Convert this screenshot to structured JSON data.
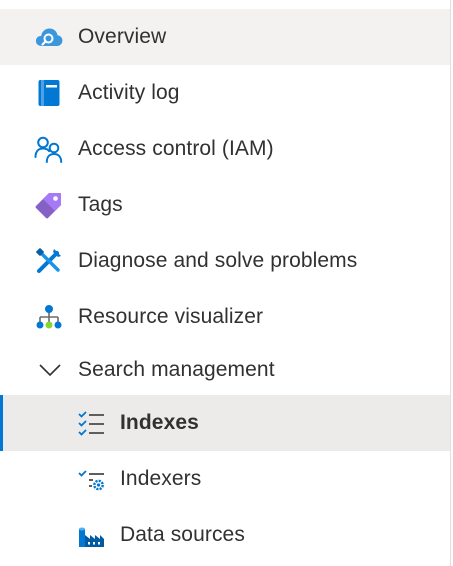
{
  "nav": {
    "items": [
      {
        "label": "Overview",
        "icon": "cloud-search-icon"
      },
      {
        "label": "Activity log",
        "icon": "activity-log-icon"
      },
      {
        "label": "Access control (IAM)",
        "icon": "people-icon"
      },
      {
        "label": "Tags",
        "icon": "tag-icon"
      },
      {
        "label": "Diagnose and solve problems",
        "icon": "wrench-icon"
      },
      {
        "label": "Resource visualizer",
        "icon": "hierarchy-icon"
      }
    ],
    "group": {
      "label": "Search management",
      "icon": "chevron-down-icon",
      "expanded": true,
      "children": [
        {
          "label": "Indexes",
          "icon": "list-check-icon",
          "selected": true
        },
        {
          "label": "Indexers",
          "icon": "indexer-gear-icon"
        },
        {
          "label": "Data sources",
          "icon": "data-sources-icon"
        }
      ]
    }
  },
  "colors": {
    "accent": "#0078d4",
    "hover_bg": "#f3f2f1",
    "selected_bg": "#edebe9",
    "text": "#323130"
  }
}
